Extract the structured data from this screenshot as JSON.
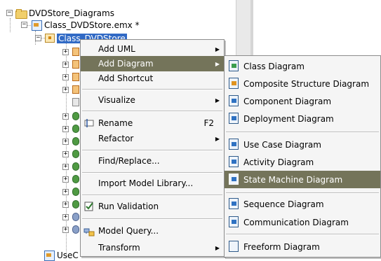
{
  "tree": {
    "root_label": "DVDStore_Diagrams",
    "model_label": "Class_DVDStore.emx *",
    "selected_label": "Class_DVDStore",
    "last_label": "UseC"
  },
  "context_menu": {
    "items": [
      {
        "label": "Add UML",
        "submenu": true
      },
      {
        "label": "Add Diagram",
        "submenu": true,
        "highlighted": true
      },
      {
        "label": "Add Shortcut"
      },
      {
        "label": "Visualize",
        "submenu": true
      },
      {
        "label": "Rename",
        "accel": "F2",
        "icon": "rename-icon"
      },
      {
        "label": "Refactor",
        "submenu": true
      },
      {
        "label": "Find/Replace..."
      },
      {
        "label": "Import Model Library..."
      },
      {
        "label": "Run Validation",
        "icon": "validation-icon"
      },
      {
        "label": "Model Query...",
        "icon": "model-query-icon"
      },
      {
        "label": "Transform",
        "submenu": true
      }
    ]
  },
  "diagram_submenu": {
    "items": [
      {
        "label": "Class Diagram",
        "icon": "class-diagram-icon"
      },
      {
        "label": "Composite Structure Diagram",
        "icon": "composite-structure-diagram-icon"
      },
      {
        "label": "Component Diagram",
        "icon": "component-diagram-icon"
      },
      {
        "label": "Deployment Diagram",
        "icon": "deployment-diagram-icon"
      },
      {
        "label": "Use Case Diagram",
        "icon": "use-case-diagram-icon"
      },
      {
        "label": "Activity Diagram",
        "icon": "activity-diagram-icon"
      },
      {
        "label": "State Machine Diagram",
        "icon": "state-machine-diagram-icon",
        "highlighted": true
      },
      {
        "label": "Sequence Diagram",
        "icon": "sequence-diagram-icon"
      },
      {
        "label": "Communication Diagram",
        "icon": "communication-diagram-icon"
      },
      {
        "label": "Freeform Diagram",
        "icon": "freeform-diagram-icon"
      }
    ]
  },
  "colors": {
    "highlight": "#74745a",
    "selection": "#316ac5",
    "menu_bg": "#f5f5f5"
  }
}
